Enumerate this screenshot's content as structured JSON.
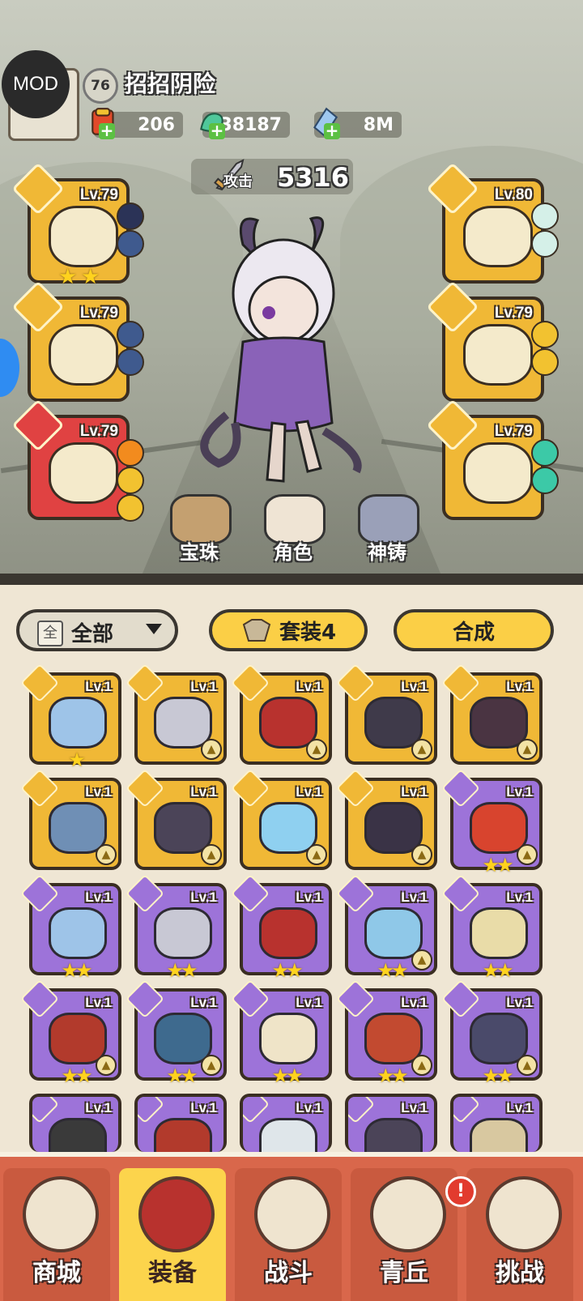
{
  "overlay": {
    "mod_label": "MOD"
  },
  "player": {
    "level": "76",
    "name": "招招阴险",
    "resources": [
      {
        "icon": "scroll-ticket-icon",
        "value": "206"
      },
      {
        "icon": "jade-dragon-icon",
        "value": "38187"
      },
      {
        "icon": "crystal-icon",
        "value": "8M"
      }
    ],
    "attack_label": "攻击",
    "attack_value": "5316"
  },
  "equipped": {
    "left": [
      {
        "slot": "weapon",
        "level": "Lv.79",
        "stars": 2,
        "gems": [
          "#2b3357",
          "#3f5a8e"
        ],
        "rarity": "gold"
      },
      {
        "slot": "helmet",
        "level": "Lv.79",
        "stars": 0,
        "gems": [
          "#3f5a8e",
          "#3f5a8e"
        ],
        "rarity": "gold"
      },
      {
        "slot": "boots",
        "level": "Lv.79",
        "stars": 0,
        "gems": [
          "#f28b1e",
          "#f2c230",
          "#f2c230"
        ],
        "rarity": "red"
      }
    ],
    "right": [
      {
        "slot": "belt",
        "level": "Lv.80",
        "stars": 0,
        "gems": [
          "#d5f0e8",
          "#d5f0e8"
        ],
        "rarity": "gold"
      },
      {
        "slot": "legs",
        "level": "Lv.79",
        "stars": 0,
        "gems": [
          "#f2c230",
          "#f2c230"
        ],
        "rarity": "gold"
      },
      {
        "slot": "necklace",
        "level": "Lv.79",
        "stars": 0,
        "gems": [
          "#3cc9a7",
          "#3cc9a7"
        ],
        "rarity": "gold"
      }
    ]
  },
  "hub": [
    {
      "label": "宝珠",
      "icon": "orb-box-icon"
    },
    {
      "label": "角色",
      "icon": "character-portrait-icon"
    },
    {
      "label": "神铸",
      "icon": "divine-forge-icon"
    }
  ],
  "filters": {
    "all_icon": "全",
    "all_label": "全部",
    "set_label": "套装4",
    "craft_label": "合成"
  },
  "inventory": [
    {
      "level": "Lv.1",
      "rarity": "gold",
      "stars": 1,
      "art": "#9ec4e8",
      "upgrade": false
    },
    {
      "level": "Lv.1",
      "rarity": "gold",
      "stars": 0,
      "art": "#c8c8d4",
      "upgrade": true
    },
    {
      "level": "Lv.1",
      "rarity": "gold",
      "stars": 0,
      "art": "#b8322e",
      "upgrade": true
    },
    {
      "level": "Lv.1",
      "rarity": "gold",
      "stars": 0,
      "art": "#3f3a4a",
      "upgrade": true
    },
    {
      "level": "Lv.1",
      "rarity": "gold",
      "stars": 0,
      "art": "#4a3442",
      "upgrade": true
    },
    {
      "level": "Lv.1",
      "rarity": "gold",
      "stars": 0,
      "art": "#6f8fb5",
      "upgrade": true
    },
    {
      "level": "Lv.1",
      "rarity": "gold",
      "stars": 0,
      "art": "#4b4458",
      "upgrade": true
    },
    {
      "level": "Lv.1",
      "rarity": "gold",
      "stars": 0,
      "art": "#8fd0f0",
      "upgrade": true
    },
    {
      "level": "Lv.1",
      "rarity": "gold",
      "stars": 0,
      "art": "#3a3346",
      "upgrade": true
    },
    {
      "level": "Lv.1",
      "rarity": "purple",
      "stars": 2,
      "art": "#d8442e",
      "upgrade": true
    },
    {
      "level": "Lv.1",
      "rarity": "purple",
      "stars": 2,
      "art": "#9ec4e8",
      "upgrade": false
    },
    {
      "level": "Lv.1",
      "rarity": "purple",
      "stars": 2,
      "art": "#c8c8d4",
      "upgrade": false
    },
    {
      "level": "Lv.1",
      "rarity": "purple",
      "stars": 2,
      "art": "#b8322e",
      "upgrade": false
    },
    {
      "level": "Lv.1",
      "rarity": "purple",
      "stars": 2,
      "art": "#8fc8e8",
      "upgrade": true
    },
    {
      "level": "Lv.1",
      "rarity": "purple",
      "stars": 2,
      "art": "#e9dca8",
      "upgrade": false
    },
    {
      "level": "Lv.1",
      "rarity": "purple",
      "stars": 2,
      "art": "#b23a2c",
      "upgrade": true
    },
    {
      "level": "Lv.1",
      "rarity": "purple",
      "stars": 2,
      "art": "#3e6a8e",
      "upgrade": true
    },
    {
      "level": "Lv.1",
      "rarity": "purple",
      "stars": 2,
      "art": "#efe4c8",
      "upgrade": false
    },
    {
      "level": "Lv.1",
      "rarity": "purple",
      "stars": 2,
      "art": "#c24a30",
      "upgrade": true
    },
    {
      "level": "Lv.1",
      "rarity": "purple",
      "stars": 2,
      "art": "#4a4a6a",
      "upgrade": true
    },
    {
      "level": "Lv.1",
      "rarity": "purple",
      "stars": 0,
      "art": "#3a3a3a",
      "upgrade": false
    },
    {
      "level": "Lv.1",
      "rarity": "purple",
      "stars": 0,
      "art": "#b23a2c",
      "upgrade": false
    },
    {
      "level": "Lv.1",
      "rarity": "purple",
      "stars": 0,
      "art": "#dfe6ea",
      "upgrade": false
    },
    {
      "level": "Lv.1",
      "rarity": "purple",
      "stars": 0,
      "art": "#4b4458",
      "upgrade": false
    },
    {
      "level": "Lv.1",
      "rarity": "purple",
      "stars": 0,
      "art": "#d8c8a0",
      "upgrade": false
    }
  ],
  "nav": [
    {
      "label": "商城",
      "icon": "shop-pavilion-icon",
      "active": false
    },
    {
      "label": "装备",
      "icon": "equipment-helmet-icon",
      "active": true
    },
    {
      "label": "战斗",
      "icon": "crossed-swords-icon",
      "active": false
    },
    {
      "label": "青丘",
      "icon": "mountain-icon",
      "active": false
    },
    {
      "label": "挑战",
      "icon": "challenge-disc-icon",
      "active": false
    }
  ],
  "nav_alert": "!"
}
